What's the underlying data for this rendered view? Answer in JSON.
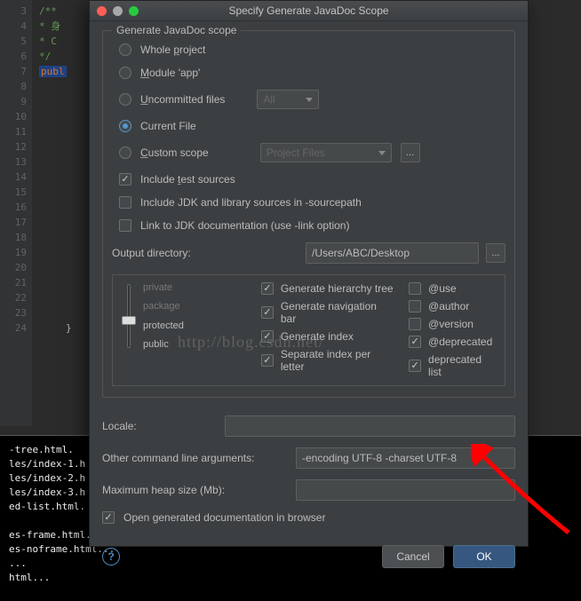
{
  "editor": {
    "lines": [
      "3",
      "4",
      "5",
      "6",
      "7",
      "8",
      "9",
      "10",
      "11",
      "12",
      "13",
      "14",
      "15",
      "16",
      "17",
      "18",
      "19",
      "20",
      "21",
      "22",
      "23",
      "24"
    ],
    "c1": "/**",
    "c2": " * 身",
    "c3": " * C",
    "c4": " */",
    "kw": "publ",
    "brace": "}"
  },
  "console": {
    "l1": "-tree.html.",
    "l2": "les/index-1.h",
    "l3": "les/index-2.h",
    "l4": "les/index-3.h",
    "l5": "ed-list.html.",
    "l6": "es-frame.html...",
    "l7": "es-noframe.html...",
    "l8": "...",
    "l9": "html..."
  },
  "dialog": {
    "title": "Specify Generate JavaDoc Scope",
    "group_title": "Generate JavaDoc scope",
    "radios": {
      "whole_project": "Whole project",
      "module": "Module 'app'",
      "uncommitted": "Uncommitted files",
      "current_file": "Current File",
      "custom_scope": "Custom scope"
    },
    "dropdowns": {
      "all": "All",
      "project_files": "Project Files"
    },
    "ellipsis": "...",
    "checks": {
      "include_test": "Include test sources",
      "include_jdk": "Include JDK and library sources in -sourcepath",
      "link_jdk": "Link to JDK documentation (use -link option)"
    },
    "output_label": "Output directory:",
    "output_value": "/Users/ABC/Desktop",
    "slider": {
      "private": "private",
      "package": "package",
      "protected": "protected",
      "public": "public"
    },
    "gen_opts": {
      "hierarchy": "Generate hierarchy tree",
      "navbar": "Generate navigation bar",
      "index": "Generate index",
      "sep_index": "Separate index per letter"
    },
    "tag_opts": {
      "use": "@use",
      "author": "@author",
      "version": "@version",
      "deprecated": "@deprecated",
      "deprecated_list": "deprecated list"
    },
    "locale_label": "Locale:",
    "other_args_label": "Other command line arguments:",
    "other_args_value": "-encoding UTF-8 -charset UTF-8",
    "heap_label": "Maximum heap size (Mb):",
    "open_doc": "Open generated documentation in browser",
    "help": "?",
    "cancel": "Cancel",
    "ok": "OK"
  },
  "watermark": "http://blog.csdn.net/"
}
